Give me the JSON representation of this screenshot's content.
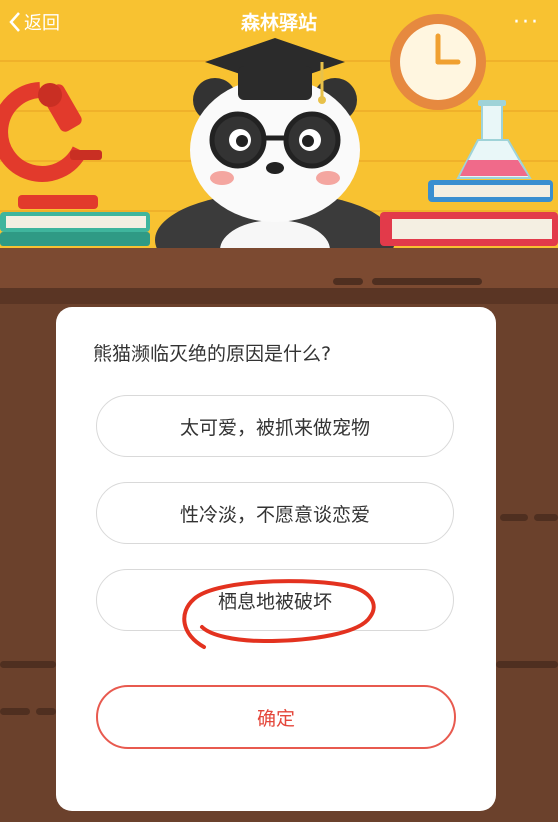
{
  "nav": {
    "back_label": "返回",
    "title": "森林驿站",
    "more_label": "···"
  },
  "quiz": {
    "question": "熊猫濒临灭绝的原因是什么?",
    "options": [
      {
        "label": "太可爱，被抓来做宠物"
      },
      {
        "label": "性冷淡，不愿意谈恋爱"
      },
      {
        "label": "栖息地被破坏",
        "annotated": true
      }
    ],
    "confirm_label": "确定"
  },
  "colors": {
    "background_yellow": "#f8c231",
    "desk_brown": "#6b412c",
    "annotation_red": "#e3321f",
    "confirm_red": "#e4473b"
  }
}
